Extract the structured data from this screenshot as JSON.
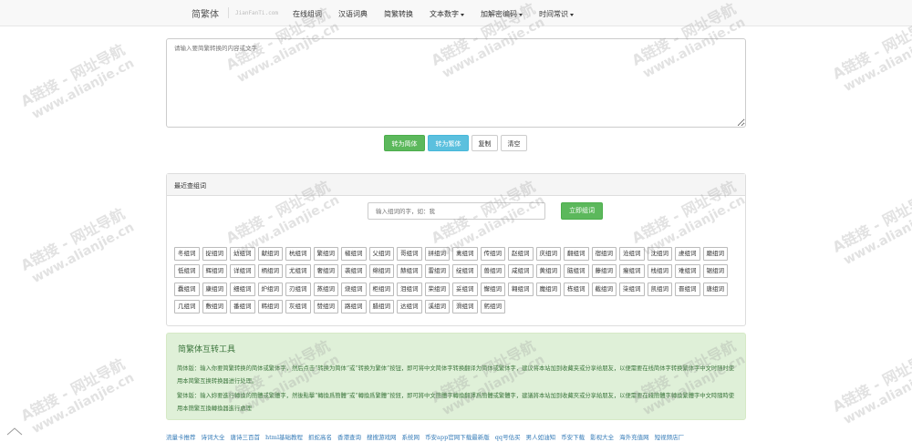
{
  "navbar": {
    "brand": "简繁体",
    "domain": "JianFanTi.com",
    "items": [
      {
        "label": "在线组词",
        "dropdown": false
      },
      {
        "label": "汉语词典",
        "dropdown": false
      },
      {
        "label": "简繁转换",
        "dropdown": false
      },
      {
        "label": "文本数字",
        "dropdown": true
      },
      {
        "label": "加解密编码",
        "dropdown": true
      },
      {
        "label": "时间常识",
        "dropdown": true
      }
    ]
  },
  "converter": {
    "placeholder": "请输入要简繁转换的内容或文字",
    "to_simplified": "转为简体",
    "to_traditional": "转为繁体",
    "copy": "复制",
    "clear": "清空"
  },
  "recent": {
    "heading": "最近查组词",
    "input_placeholder": "输入组词的字，如：我",
    "submit": "立即组词",
    "tags": [
      "冬组词",
      "捉组词",
      "幼组词",
      "献组词",
      "杭组词",
      "繁组词",
      "椒组词",
      "父组词",
      "哥组词",
      "拼组词",
      "禽组词",
      "传组词",
      "赵组词",
      "庆组词",
      "翻组词",
      "宿组词",
      "沧组词",
      "沈组词",
      "虔组词",
      "磨组词",
      "低组词",
      "辉组词",
      "详组词",
      "柄组词",
      "尤组词",
      "奢组词",
      "袭组词",
      "绵组词",
      "赫组词",
      "雷组词",
      "绽组词",
      "兽组词",
      "咸组词",
      "黄组词",
      "脑组词",
      "藤组词",
      "瘦组词",
      "栈组词",
      "难组词",
      "锯组词",
      "蠢组词",
      "康组词",
      "细组词",
      "炉组词",
      "刃组词",
      "蒸组词",
      "烧组词",
      "柜组词",
      "泪组词",
      "荣组词",
      "妥组词",
      "懈组词",
      "翱组词",
      "魔组词",
      "栋组词",
      "截组词",
      "柒组词",
      "凯组词",
      "晋组词",
      "唐组词",
      "几组词",
      "敷组词",
      "番组词",
      "韩组词",
      "灰组词",
      "赞组词",
      "路组词",
      "腊组词",
      "达组词",
      "溪组词",
      "滑组词",
      "躬组词"
    ]
  },
  "info": {
    "title": "简繁体互转工具",
    "p1": "简体版：输入你要简繁转换的简体或繁体字，然后点击“转换为简体”或“转换为繁体”按钮，即可将中文简体字转换翻译为简体或繁体字，建议将本站加到收藏夹或分享给朋友，以便需要在线简体字转换繁体字中文时随时使用本简繁互换转换器进行处理。",
    "p2": "繁体版：输入妳要進行轉換的簡體或繁體字，然後點擊“轉換爲簡體”或“轉換爲繁體”按鈕，即可將中文簡體字轉換翻譯爲簡體或繁體字，建議將本站加到收藏夾或分享給朋友，以便需要在綫簡體字轉換繁體字中文時隨時使用本簡繁互換轉換器進行處理"
  },
  "footer_links": [
    "流量卡推荐",
    "诗词大全",
    "唐诗三百首",
    "html基础教程",
    "抓蛇高名",
    "香港查询",
    "搜搜游戏网",
    "系统网",
    "币安app官网下载最新版",
    "qq号估买",
    "男人如油知",
    "币安下载",
    "影视大全",
    "海外充值网",
    "短视频店厂"
  ],
  "watermark": {
    "line1": "A链接 - 网址导航",
    "line2": "www.alianjie.cn"
  }
}
